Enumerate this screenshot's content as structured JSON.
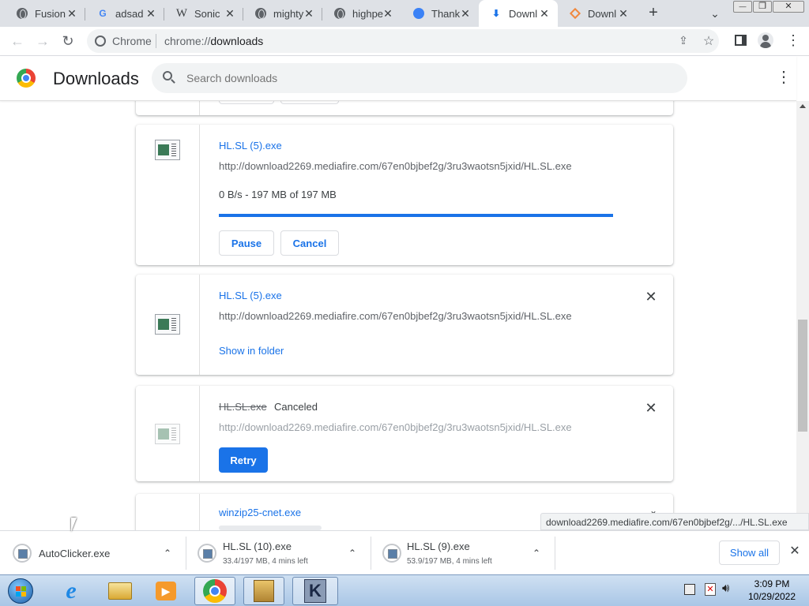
{
  "tabs": [
    {
      "title": "Fusion",
      "icon": "globe-icon"
    },
    {
      "title": "adsad",
      "icon": "google-icon"
    },
    {
      "title": "Sonic",
      "icon": "wikipedia-icon"
    },
    {
      "title": "mighty",
      "icon": "globe-icon"
    },
    {
      "title": "highpe",
      "icon": "globe-icon"
    },
    {
      "title": "Thank",
      "icon": "site-icon"
    },
    {
      "title": "Downl",
      "icon": "download-icon",
      "active": true
    },
    {
      "title": "Downl",
      "icon": "diamond-icon"
    }
  ],
  "window": {
    "new_tab": "+",
    "tab_menu": "⌄",
    "minimize": "—",
    "restore": "❐",
    "close": "✕"
  },
  "address": {
    "site_label": "Chrome",
    "url_prefix": "chrome://",
    "url_path": "downloads"
  },
  "header": {
    "title": "Downloads",
    "search_placeholder": "Search downloads",
    "menu": "⋮"
  },
  "downloads": [
    {
      "name": "HL.SL (5).exe",
      "url": "http://download2269.mediafire.com/67en0bjbef2g/3ru3waotsn5jxid/HL.SL.exe",
      "status": "0 B/s - 197 MB of 197 MB",
      "progress_percent": 100,
      "buttons": [
        "Pause",
        "Cancel"
      ]
    },
    {
      "name": "HL.SL (5).exe",
      "url": "http://download2269.mediafire.com/67en0bjbef2g/3ru3waotsn5jxid/HL.SL.exe",
      "link": "Show in folder"
    },
    {
      "name": "HL.SL.exe",
      "state": "Canceled",
      "url": "http://download2269.mediafire.com/67en0bjbef2g/3ru3waotsn5jxid/HL.SL.exe",
      "button": "Retry"
    },
    {
      "name": "winzip25-cnet.exe"
    }
  ],
  "tooltip_url": "download2269.mediafire.com/67en0bjbef2g/.../HL.SL.exe",
  "shelf": {
    "items": [
      {
        "name": "AutoClicker.exe",
        "status": ""
      },
      {
        "name": "HL.SL (10).exe",
        "status": "33.4/197 MB, 4 mins left"
      },
      {
        "name": "HL.SL (9).exe",
        "status": "53.9/197 MB, 4 mins left"
      }
    ],
    "show_all": "Show all",
    "close": "✕"
  },
  "taskbar": {
    "time": "3:09 PM",
    "date": "10/29/2022"
  },
  "colors": {
    "accent": "#1a73e8",
    "tabstrip": "#dee1e6"
  }
}
